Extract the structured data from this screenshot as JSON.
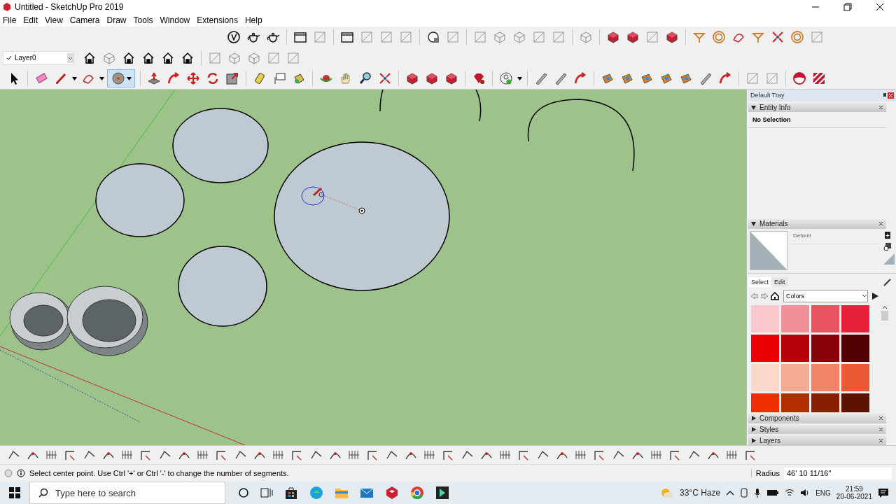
{
  "window": {
    "title": "Untitled - SketchUp Pro 2019"
  },
  "menu": [
    "File",
    "Edit",
    "View",
    "Camera",
    "Draw",
    "Tools",
    "Window",
    "Extensions",
    "Help"
  ],
  "layer": {
    "value": "Layer0"
  },
  "drawing_toolbar": {
    "circle_tool": {
      "selected": true
    }
  },
  "tray": {
    "title": "Default Tray"
  },
  "entity_info": {
    "title": "Entity Info",
    "expanded": true,
    "selection": "No Selection"
  },
  "materials": {
    "title": "Materials",
    "expanded": true,
    "material_name": "Default",
    "tabs": [
      {
        "label": "Select",
        "selected": true
      },
      {
        "label": "Edit",
        "selected": false
      }
    ],
    "library": "Colors",
    "swatches": [
      {
        "color": "#f8c8cc"
      },
      {
        "color": "#f0909a"
      },
      {
        "color": "#e85462"
      },
      {
        "color": "#e8203a"
      },
      {
        "color": "#e80000"
      },
      {
        "color": "#b80008"
      },
      {
        "color": "#880008"
      },
      {
        "color": "#500000"
      },
      {
        "color": "#fcd8cc"
      },
      {
        "color": "#f4aa94"
      },
      {
        "color": "#f08464"
      },
      {
        "color": "#ec5834"
      },
      {
        "color": "#ee3000"
      },
      {
        "color": "#b42c00"
      },
      {
        "color": "#882000"
      },
      {
        "color": "#5c1400"
      }
    ]
  },
  "collapsed_panels": [
    {
      "title": "Components",
      "expanded": false
    },
    {
      "title": "Styles",
      "expanded": false
    },
    {
      "title": "Layers",
      "expanded": false
    }
  ],
  "status": {
    "text": "Select center point. Use Ctrl '+' or Ctrl '-' to change the number of segments.",
    "measure_label": "Radius",
    "measure_value": "46' 10 11/16\""
  },
  "taskbar": {
    "search_placeholder": "Type here to search",
    "weather": "33°C Haze",
    "language": "ENG",
    "time": "21:59",
    "date": "20-06-2021"
  }
}
